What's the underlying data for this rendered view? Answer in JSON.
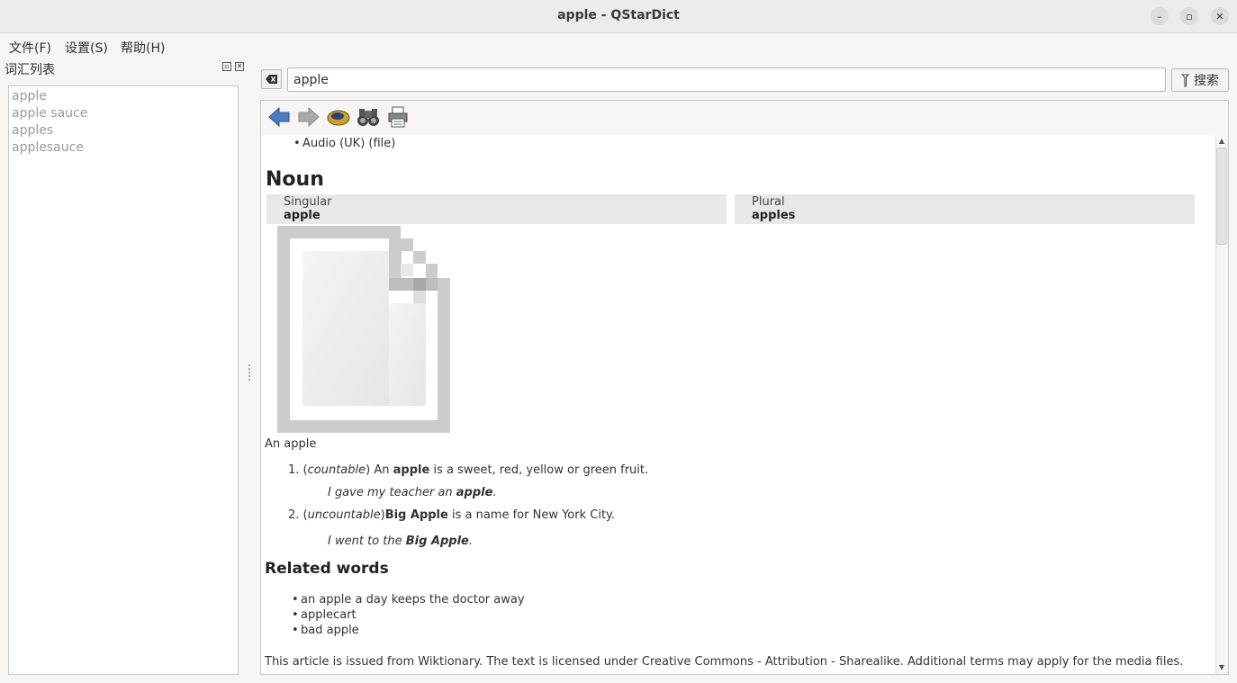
{
  "window": {
    "title": "apple - QStarDict",
    "minimize_glyph": "–",
    "maximize_glyph": "▫",
    "close_glyph": "✕"
  },
  "menu": {
    "items": [
      "文件(F)",
      "设置(S)",
      "帮助(H)"
    ],
    "items_underline": [
      "F",
      "S",
      "H"
    ]
  },
  "wordlist": {
    "title": "词汇列表",
    "items": [
      "apple",
      "apple sauce",
      "apples",
      "applesauce"
    ]
  },
  "search": {
    "value": "apple",
    "button_label": "搜索"
  },
  "toolbar": {
    "icons": [
      "back-arrow-icon",
      "forward-arrow-icon",
      "speaker-icon",
      "binoculars-icon",
      "printer-icon"
    ]
  },
  "article": {
    "audio_item": "Audio (UK)  (file)",
    "heading_noun": "Noun",
    "singular_label": "Singular",
    "singular_word": "apple",
    "plural_label": "Plural",
    "plural_word": "apples",
    "image_caption": "An apple",
    "definitions": [
      {
        "number": "1.",
        "tag": "countable",
        "pre": " An ",
        "bold": "apple",
        "post": " is a sweet, red, yellow or green fruit.",
        "example_pre": "I gave my teacher an ",
        "example_bold": "apple",
        "example_post": "."
      },
      {
        "number": "2.",
        "tag": "uncountable",
        "pre": "",
        "bold": "Big Apple",
        "post": " is a name for New York City.",
        "example_pre": "I went to the ",
        "example_bold": "Big Apple",
        "example_post": "."
      }
    ],
    "heading_related": "Related words",
    "related": [
      "an apple a day keeps the doctor away",
      "applecart",
      "bad apple"
    ],
    "footer": "This article is issued from Wiktionary. The text is licensed under Creative Commons - Attribution - Sharealike. Additional terms may apply for the media files."
  },
  "colors": {
    "accent_blue": "#3f6fb3",
    "muted_text": "#9a9a9a"
  }
}
